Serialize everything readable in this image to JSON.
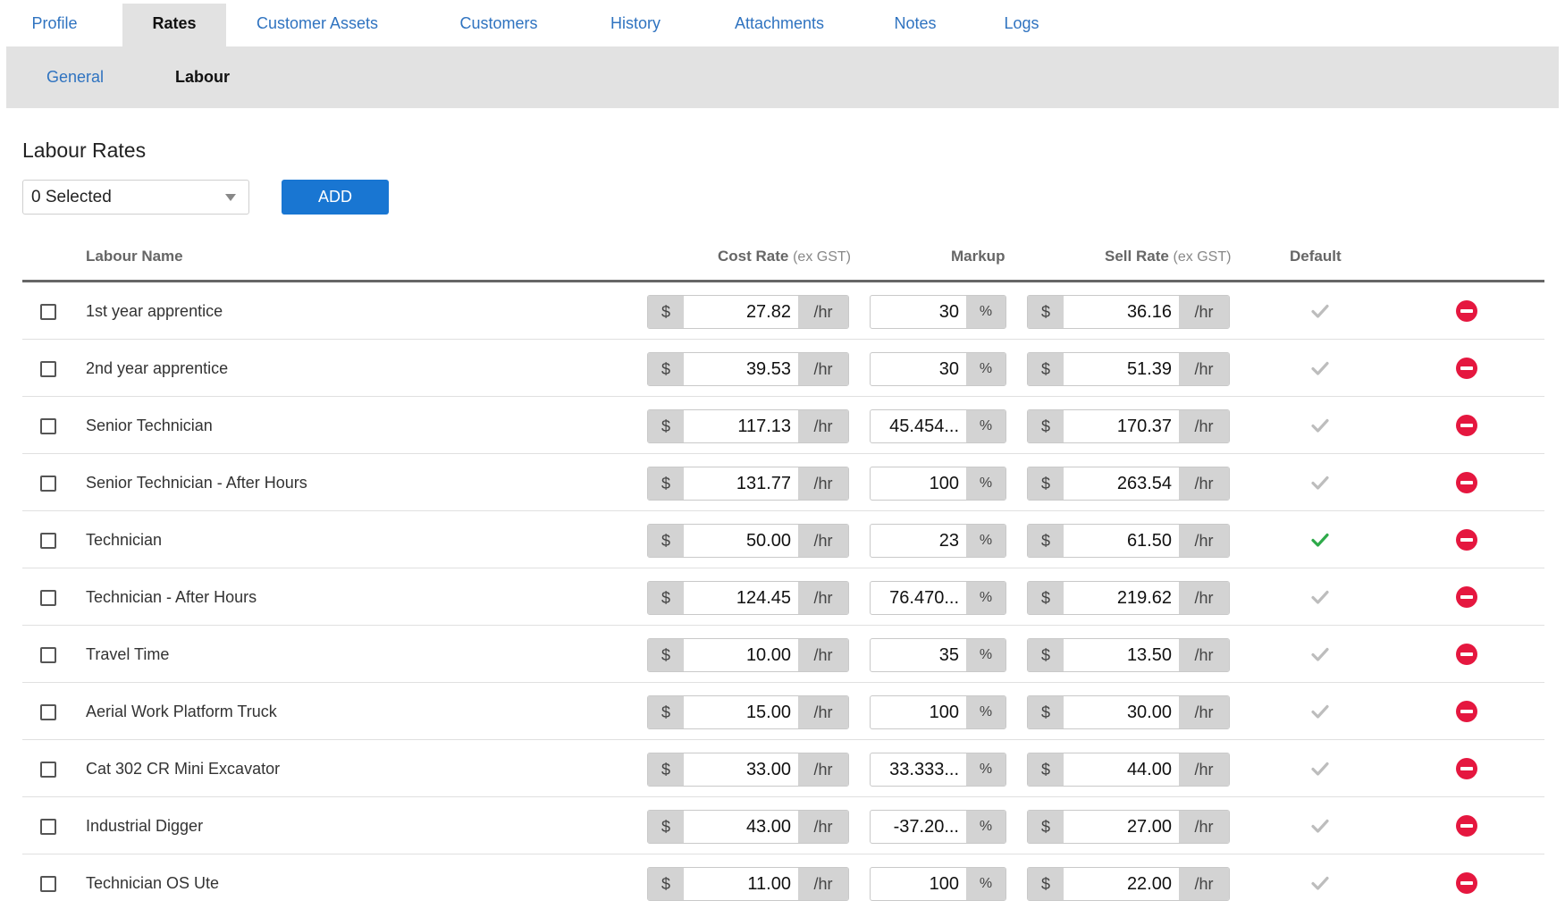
{
  "top_tabs": [
    {
      "label": "Profile"
    },
    {
      "label": "Rates"
    },
    {
      "label": "Customer Assets"
    },
    {
      "label": "Customers"
    },
    {
      "label": "History"
    },
    {
      "label": "Attachments"
    },
    {
      "label": "Notes"
    },
    {
      "label": "Logs"
    }
  ],
  "active_top_tab": "Rates",
  "sub_tabs": [
    {
      "label": "General"
    },
    {
      "label": "Labour"
    }
  ],
  "active_sub_tab": "Labour",
  "section_title": "Labour Rates",
  "selector": {
    "value": "0 Selected"
  },
  "add_label": "ADD",
  "table": {
    "headers": {
      "name": "Labour Name",
      "cost": "Cost Rate",
      "cost_sub": "(ex GST)",
      "markup": "Markup",
      "sell": "Sell Rate",
      "sell_sub": "(ex GST)",
      "default": "Default"
    },
    "currency": "$",
    "rate_unit": "/hr",
    "percent": "%",
    "rows": [
      {
        "name": "1st year apprentice",
        "cost": "27.82",
        "markup": "30",
        "sell": "36.16",
        "default": false
      },
      {
        "name": "2nd year apprentice",
        "cost": "39.53",
        "markup": "30",
        "sell": "51.39",
        "default": false
      },
      {
        "name": "Senior Technician",
        "cost": "117.13",
        "markup": "45.454...",
        "sell": "170.37",
        "default": false
      },
      {
        "name": "Senior Technician - After Hours",
        "cost": "131.77",
        "markup": "100",
        "sell": "263.54",
        "default": false
      },
      {
        "name": "Technician",
        "cost": "50.00",
        "markup": "23",
        "sell": "61.50",
        "default": true
      },
      {
        "name": "Technician - After Hours",
        "cost": "124.45",
        "markup": "76.470...",
        "sell": "219.62",
        "default": false
      },
      {
        "name": "Travel Time",
        "cost": "10.00",
        "markup": "35",
        "sell": "13.50",
        "default": false
      },
      {
        "name": "Aerial Work Platform Truck",
        "cost": "15.00",
        "markup": "100",
        "sell": "30.00",
        "default": false
      },
      {
        "name": "Cat 302 CR Mini Excavator",
        "cost": "33.00",
        "markup": "33.333...",
        "sell": "44.00",
        "default": false
      },
      {
        "name": "Industrial Digger",
        "cost": "43.00",
        "markup": "-37.20...",
        "sell": "27.00",
        "default": false
      },
      {
        "name": "Technician OS Ute",
        "cost": "11.00",
        "markup": "100",
        "sell": "22.00",
        "default": false
      }
    ]
  },
  "colors": {
    "link": "#2f73c0",
    "accent": "#1976d2",
    "default_on": "#2eaa4a",
    "default_off": "#bdbdbd",
    "delete": "#e5173f"
  }
}
